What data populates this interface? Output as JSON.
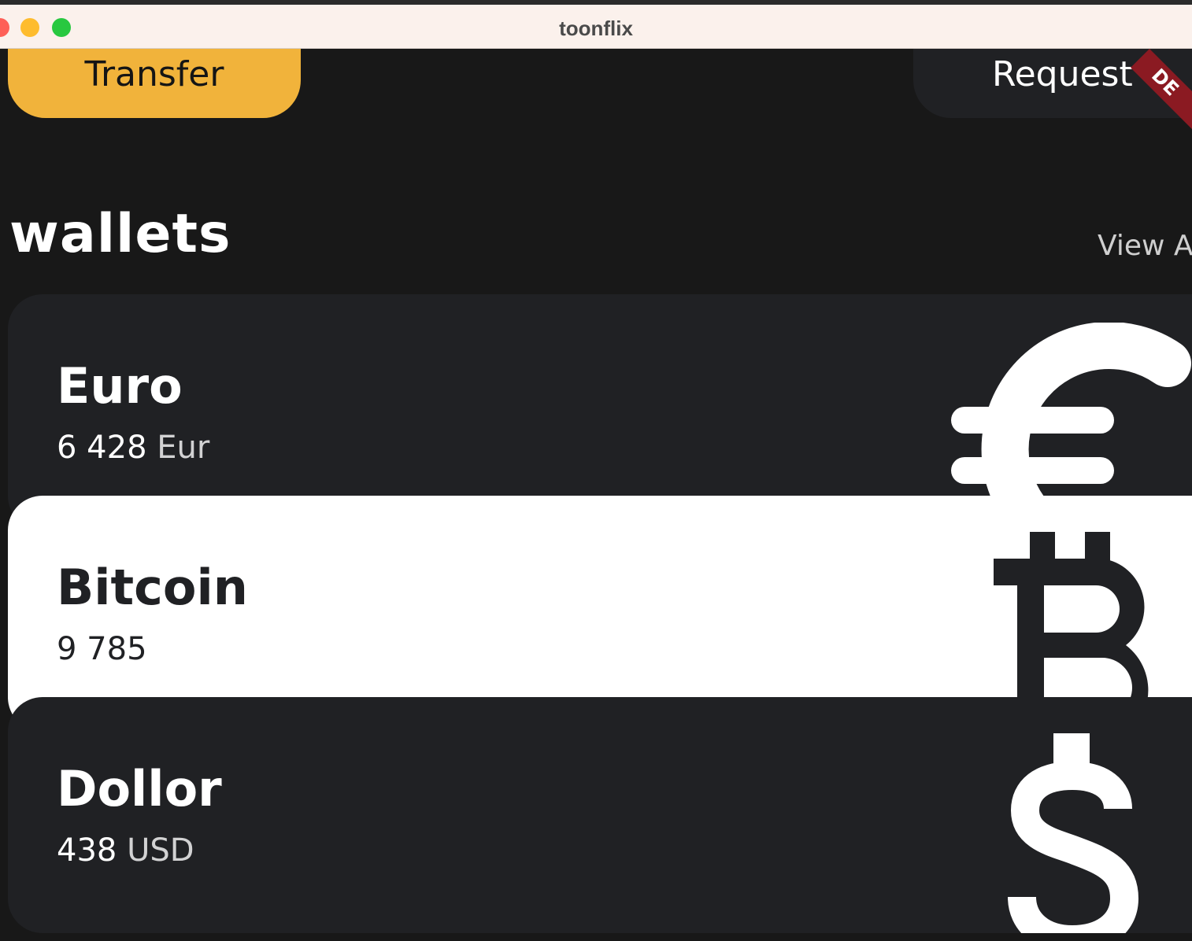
{
  "window": {
    "title": "toonflix"
  },
  "actions": {
    "transfer_label": "Transfer",
    "request_label": "Request"
  },
  "debug_banner": "DE",
  "section": {
    "title": "wallets",
    "view_all": "View All"
  },
  "cards": [
    {
      "name": "Euro",
      "amount": "6 428",
      "code": "Eur",
      "icon": "euro-icon",
      "theme": "dark"
    },
    {
      "name": "Bitcoin",
      "amount": "9 785",
      "code": "",
      "icon": "bitcoin-icon",
      "theme": "light"
    },
    {
      "name": "Dollor",
      "amount": "438",
      "code": "USD",
      "icon": "dollar-icon",
      "theme": "dark"
    }
  ],
  "colors": {
    "background": "#181818",
    "card_dark": "#202124",
    "card_light": "#ffffff",
    "accent": "#f1b33b",
    "titlebar": "#fbf1ec"
  }
}
